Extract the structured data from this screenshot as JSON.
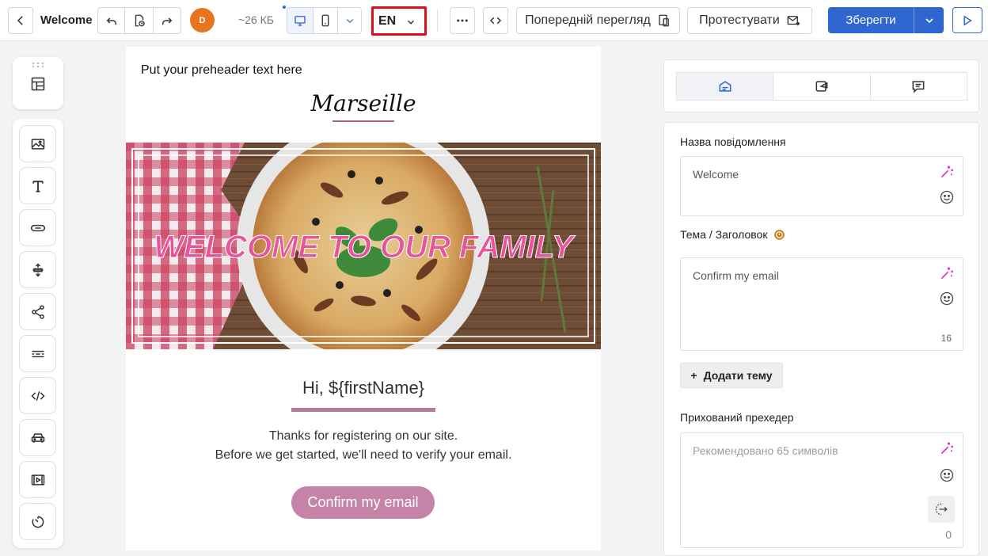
{
  "header": {
    "title": "Welcome",
    "avatar_initial": "D",
    "size": "~26 КБ",
    "language": "EN",
    "preview_label": "Попередній перегляд",
    "test_label": "Протестувати",
    "save_label": "Зберегти"
  },
  "email": {
    "preheader": "Put your preheader text here",
    "brand": "Marseille",
    "hero_headline": "WELCOME TO OUR FAMILY",
    "greeting": "Hi, ${firstName}",
    "body_line_1": "Thanks for registering on our site.",
    "body_line_2": "Before we get started, we'll need to verify your email.",
    "cta_label": "Confirm my email"
  },
  "panel": {
    "message_name_label": "Назва повідомлення",
    "message_name_value": "Welcome",
    "subject_label": "Тема / Заголовок",
    "subject_value": "Confirm my email",
    "subject_count": "16",
    "add_subject_label": "Додати тему",
    "preheader_label": "Прихований прехедер",
    "preheader_placeholder": "Рекомендовано 65 символів",
    "preheader_count": "0"
  },
  "colors": {
    "accent": "#2f66d0",
    "brand_pink": "#c583a8",
    "highlight_border": "#e0101a",
    "avatar": "#e8741e"
  },
  "icons": {
    "toolbox": [
      "image-icon",
      "text-icon",
      "button-icon",
      "spacer-icon",
      "social-icon",
      "divider-icon",
      "html-icon",
      "menu-icon",
      "video-icon",
      "timer-icon"
    ]
  }
}
